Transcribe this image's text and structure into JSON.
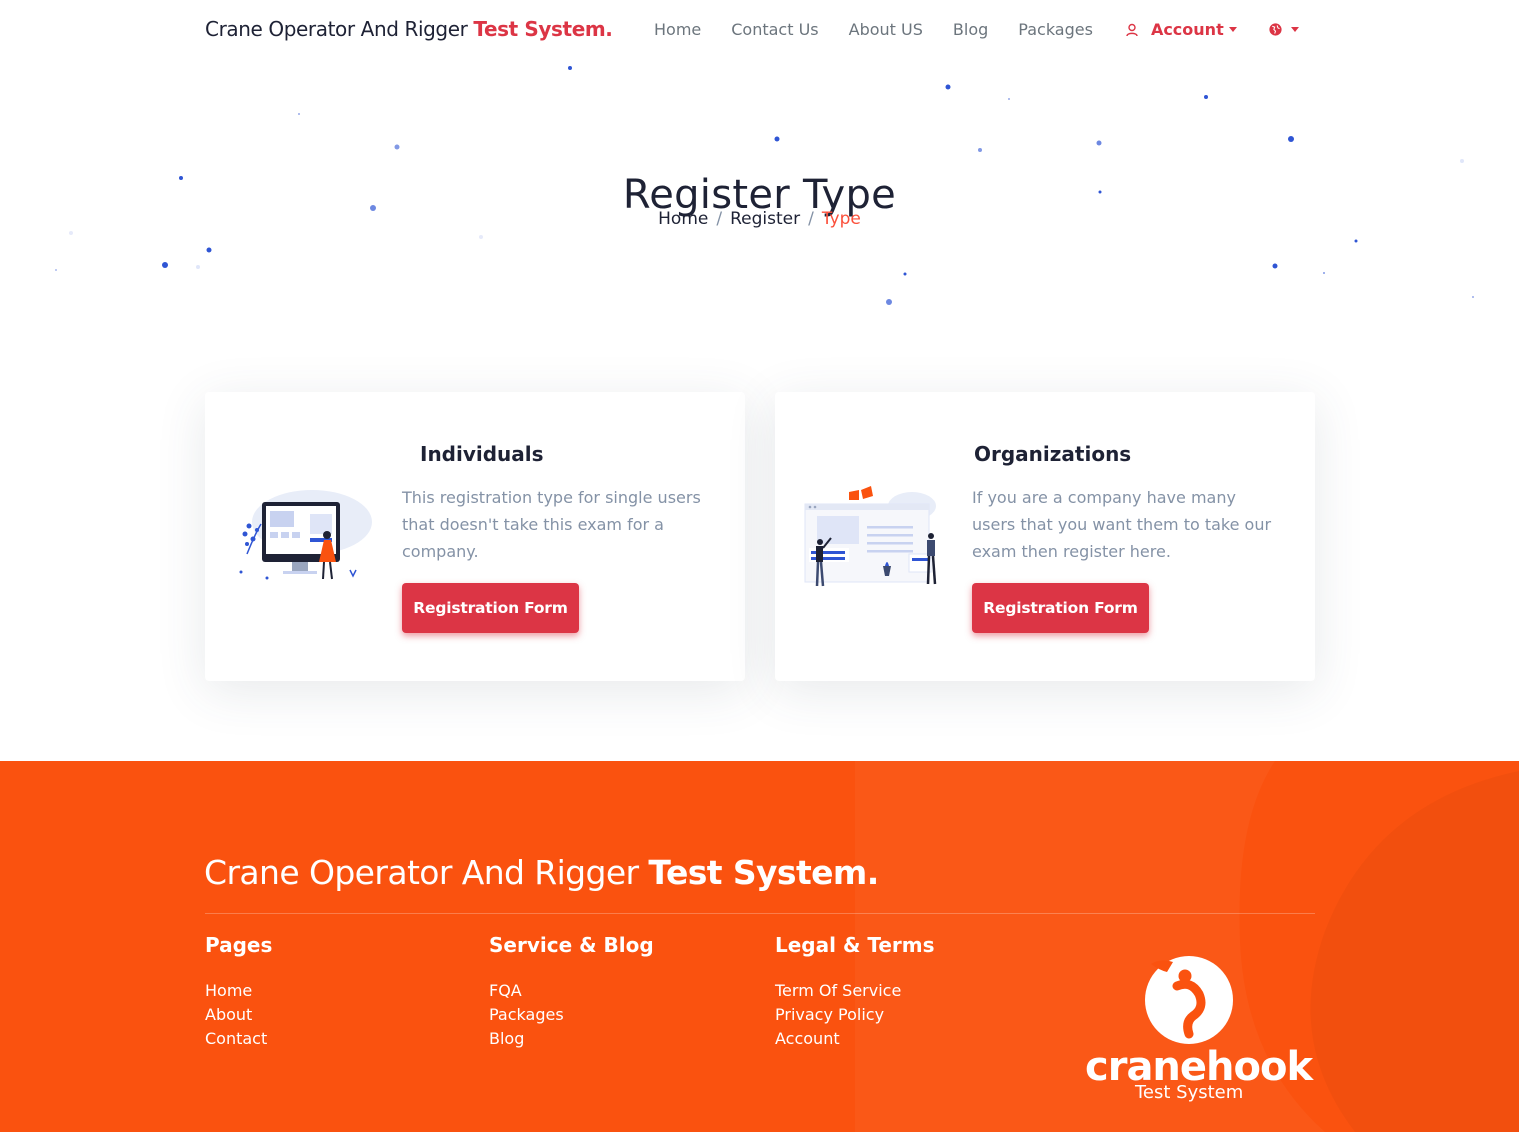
{
  "navbar": {
    "brand_regular": "Crane Operator And Rigger ",
    "brand_bold": "Test System.",
    "links": [
      "Home",
      "Contact Us",
      "About US",
      "Blog",
      "Packages"
    ],
    "account_label": "Account",
    "accent_color": "#dc3545"
  },
  "hero": {
    "title": "Register Type",
    "breadcrumb": [
      "Home",
      "Register",
      "Type"
    ]
  },
  "cards": [
    {
      "title": "Individuals",
      "description": "This registration type for single users that doesn't take this exam for a company.",
      "button_label": "Registration Form",
      "icon": "computer-person-illustration"
    },
    {
      "title": "Organizations",
      "description": "If you are a company have many users that you want them to take our exam then register here.",
      "button_label": "Registration Form",
      "icon": "team-dashboard-illustration"
    }
  ],
  "footer": {
    "brand_regular": "Crane Operator And Rigger ",
    "brand_bold": "Test System.",
    "background_color": "#fa520f",
    "columns": [
      {
        "title": "Pages",
        "links": [
          "Home",
          "About",
          "Contact"
        ]
      },
      {
        "title": "Service & Blog",
        "links": [
          "FQA",
          "Packages",
          "Blog"
        ]
      },
      {
        "title": "Legal & Terms",
        "links": [
          "Term Of Service",
          "Privacy Policy",
          "Account"
        ]
      }
    ],
    "logo_word": "cranehook",
    "logo_sub": "Test System"
  }
}
